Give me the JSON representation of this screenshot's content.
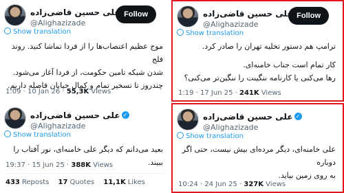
{
  "author": {
    "name": "علی حسین قاضی‌زاده",
    "handle": "@Alighazizade"
  },
  "labels": {
    "follow": "Follow",
    "show_translation": "Show translation",
    "views": "Views",
    "reposts": "Reposts",
    "quotes": "Quotes",
    "likes": "Likes",
    "more": "…"
  },
  "tweets": [
    {
      "text_lines": [
        "موج عظیم اعتصاب‌ها را از فردا تماشا کنید. روند فلج",
        "شدن شبکه تامین حکومت، از فردا آغاز می‌شود.",
        "چندروز تا تسخیر تمام و کمال خیابان فاصله داریم."
      ],
      "time": "1:09",
      "date": "10 Jan 26",
      "views": "55,3K"
    },
    {
      "text_lines": [
        "ترامپ هم دستور تخلیه تهران را صادر کرد.",
        "",
        "کار تمام است جناب خامنه‌ای.",
        "رها می‌کنی یا کارنامه ننگینت را ننگین‌تر می‌کنی؟"
      ],
      "time": "1:19",
      "date": "17 Jun 25",
      "views": "241K"
    },
    {
      "text_lines": [
        "بعید می‌دانم که دیگر علی خامنه‌ای، نور آفتاب را ببیند."
      ],
      "time": "19:37",
      "date": "15 Jun 25",
      "views": "388K",
      "reposts": "433",
      "quotes": "17",
      "likes": "11,1K"
    },
    {
      "text_lines": [
        "علی خامنه‌ای، دیگر مرده‌ای بیش نیست، حتی اگر دوباره",
        "به روی زمین بیاید."
      ],
      "time": "10:24",
      "date": "24 Jun 25",
      "views": "327K"
    }
  ],
  "colors": {
    "frame": "#e0171e",
    "link": "#1d9bf0",
    "follow_bg": "#0f1419",
    "muted": "#536471"
  }
}
